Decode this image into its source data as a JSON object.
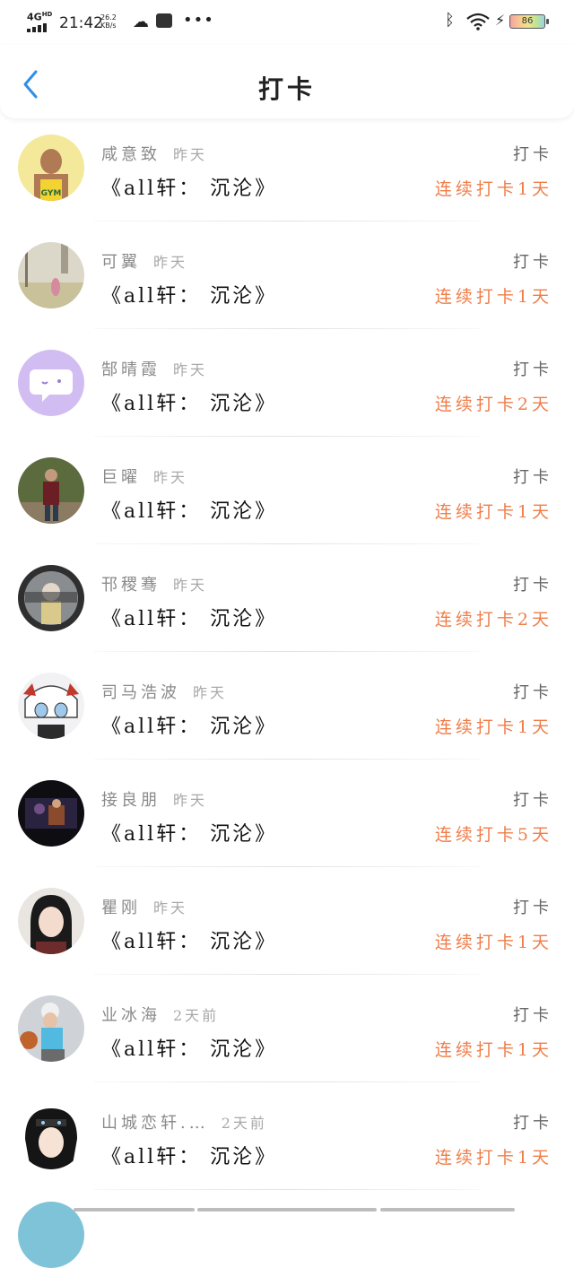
{
  "status_bar": {
    "network": "4G",
    "network_sup": "HD",
    "time": "21:42",
    "speed_value": "26.2",
    "speed_unit": "KB/s",
    "battery": "86"
  },
  "header": {
    "title": "打卡"
  },
  "items": [
    {
      "name": "咸意致",
      "time": "昨天",
      "book": "《all轩： 沉沦》",
      "action": "打卡",
      "streak": "连续打卡1天"
    },
    {
      "name": "可翼",
      "time": "昨天",
      "book": "《all轩： 沉沦》",
      "action": "打卡",
      "streak": "连续打卡1天"
    },
    {
      "name": "郜晴霞",
      "time": "昨天",
      "book": "《all轩： 沉沦》",
      "action": "打卡",
      "streak": "连续打卡2天"
    },
    {
      "name": "巨曜",
      "time": "昨天",
      "book": "《all轩： 沉沦》",
      "action": "打卡",
      "streak": "连续打卡1天"
    },
    {
      "name": "邗稷骞",
      "time": "昨天",
      "book": "《all轩： 沉沦》",
      "action": "打卡",
      "streak": "连续打卡2天"
    },
    {
      "name": "司马浩波",
      "time": "昨天",
      "book": "《all轩： 沉沦》",
      "action": "打卡",
      "streak": "连续打卡1天"
    },
    {
      "name": "接良朋",
      "time": "昨天",
      "book": "《all轩： 沉沦》",
      "action": "打卡",
      "streak": "连续打卡5天"
    },
    {
      "name": "瞿刚",
      "time": "昨天",
      "book": "《all轩： 沉沦》",
      "action": "打卡",
      "streak": "连续打卡1天"
    },
    {
      "name": "业冰海",
      "time": "2天前",
      "book": "《all轩： 沉沦》",
      "action": "打卡",
      "streak": "连续打卡1天"
    },
    {
      "name": "山城恋轩.…",
      "time": "2天前",
      "book": "《all轩： 沉沦》",
      "action": "打卡",
      "streak": "连续打卡1天"
    }
  ],
  "colors": {
    "accent": "#ef7e4a",
    "back_arrow": "#2e8fe8"
  }
}
